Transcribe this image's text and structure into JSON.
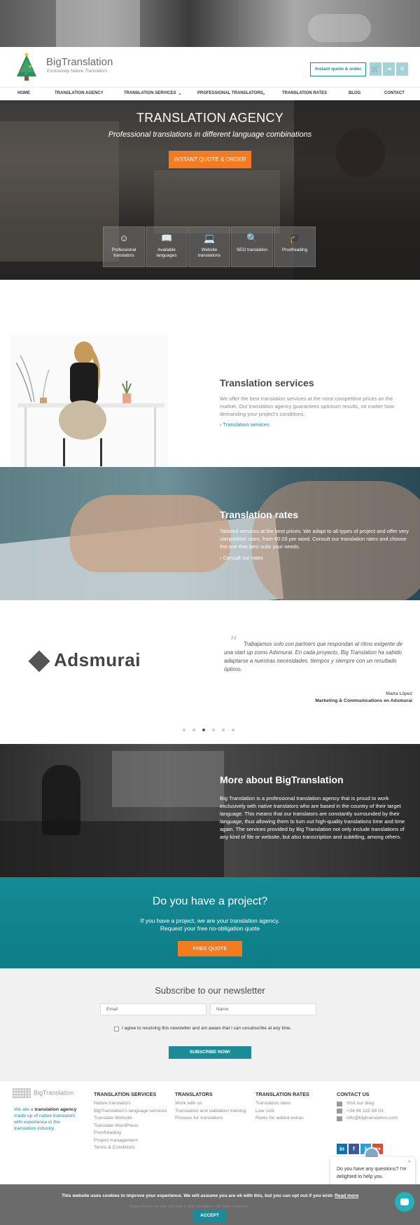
{
  "brand": {
    "title": "BigTranslation",
    "tagline": "Exclusively Native Translators"
  },
  "header": {
    "quote_button": "Instant quote & order",
    "icons": [
      "cart-icon",
      "login-icon",
      "language-flag-icon"
    ]
  },
  "nav": {
    "items": [
      {
        "label": "HOME"
      },
      {
        "label": "TRANSLATION AGENCY"
      },
      {
        "label": "TRANSLATION SERVICES",
        "dropdown": true
      },
      {
        "label": "PROFESSIONAL TRANSLATORS",
        "dropdown": true
      },
      {
        "label": "TRANSLATION RATES"
      },
      {
        "label": "BLOG"
      },
      {
        "label": "CONTACT"
      }
    ]
  },
  "hero": {
    "title": "TRANSLATION AGENCY",
    "subtitle": "Professional translations in different language combinations",
    "button": "INSTANT QUOTE & ORDER",
    "features": [
      {
        "icon": "translator-face-icon",
        "line1": "Professional",
        "line2": "translators"
      },
      {
        "icon": "book-icon",
        "line1": "Available",
        "line2": "languages"
      },
      {
        "icon": "laptop-icon",
        "line1": "Website",
        "line2": "translations"
      },
      {
        "icon": "seo-search-icon",
        "line1": "SEO translation",
        "line2": ""
      },
      {
        "icon": "graduation-cap-icon",
        "line1": "Proofreading",
        "line2": ""
      }
    ]
  },
  "services": {
    "title": "Translation services",
    "text": "We offer the best translation services at the most competitive prices on the market. Our translation agency guarantees optimum results, no matter how demanding your project's conditions.",
    "link": "› Translation services"
  },
  "rates": {
    "title": "Translation rates",
    "text": "Tailored services at the best prices. We adapt to all types of project and offer very competitive rates, from €0.03 per word. Consult our translation rates and choose the one that best suits your needs.",
    "link": "› Consult our rates"
  },
  "testimonial": {
    "logo_text": "Adsmurai",
    "quote": "Trabajamos solo con partners que respondan al ritmo exigente de una start up como Adsmurai. En cada proyecto, Big Translation ha sabido adaptarse a nuestras necesidades, tiempos y siempre con un resultado óptimo.",
    "author": "Marta López",
    "role": "Marketing & Communications en Adsmurai",
    "dots": 6,
    "active_dot": 2
  },
  "about": {
    "title": "More about BigTranslation",
    "text": "Big Translation is a professional translation agency that is proud to work exclusively with native translators who are based in the country of their target language. This means that our translators are constantly surrounded by their language, thus allowing them to turn out high-quality translations time and time again. The services provided by Big Translation not only include translations of any kind of file or website, but also transcription and subtitling, among others."
  },
  "project": {
    "title": "Do you have a project?",
    "line1": "If you have a project, we are your translation agency.",
    "line2": "Request your free no-obligation quote",
    "button": "FREE QUOTE"
  },
  "newsletter": {
    "title": "Subscribe to our newsletter",
    "email_placeholder": "Email",
    "name_placeholder": "Name",
    "agree": "I agree to receiving this newsletter and am aware that I can unsubscribe at any time.",
    "button": "SUBSCRIBE NOW!"
  },
  "footer": {
    "logo_text": "BigTranslation",
    "about_prefix": "We are a ",
    "about_bold": "translation agency",
    "about_suffix": " made up of native translators with experience in the translation industry.",
    "columns": [
      {
        "title": "TRANSLATION SERVICES",
        "items": [
          "Native translators",
          "BigTranslation's language services",
          "Translate Website",
          "Translate WordPress",
          "Proofreading",
          "Project management",
          "Terms & Conditions"
        ]
      },
      {
        "title": "TRANSLATORS",
        "items": [
          "Work with us",
          "Translation and validation training",
          "Process for translators"
        ]
      },
      {
        "title": "TRANSLATION RATES",
        "items": [
          "Translation rates",
          "Low cost",
          "Rates for added extras"
        ]
      }
    ],
    "contact": {
      "title": "CONTACT US",
      "items": [
        "Visit our blog",
        "+34 96 115 58 03",
        "info@bigtranslation.com"
      ]
    },
    "social": [
      {
        "icon": "linkedin-icon",
        "glyph": "in",
        "color": "#0077b5"
      },
      {
        "icon": "facebook-icon",
        "glyph": "f",
        "color": "#3b5998"
      },
      {
        "icon": "twitter-icon",
        "glyph": "t",
        "color": "#1da1f2"
      },
      {
        "icon": "google-plus-icon",
        "glyph": "g+",
        "color": "#dd4b39"
      }
    ]
  },
  "chat": {
    "message": "Do you have any questions? I'm delighted to help you."
  },
  "cookie": {
    "text": "This website uses cookies to improve your experience. We will assume you are ok with this, but you can opt out if you wish",
    "link": "Read more",
    "ghost": "Todos el texto de este sitio web © BigTranslation – All rights reserved",
    "button": "ACCEPT"
  },
  "colors": {
    "accent": "#1b8c97",
    "orange": "#f47b20"
  }
}
